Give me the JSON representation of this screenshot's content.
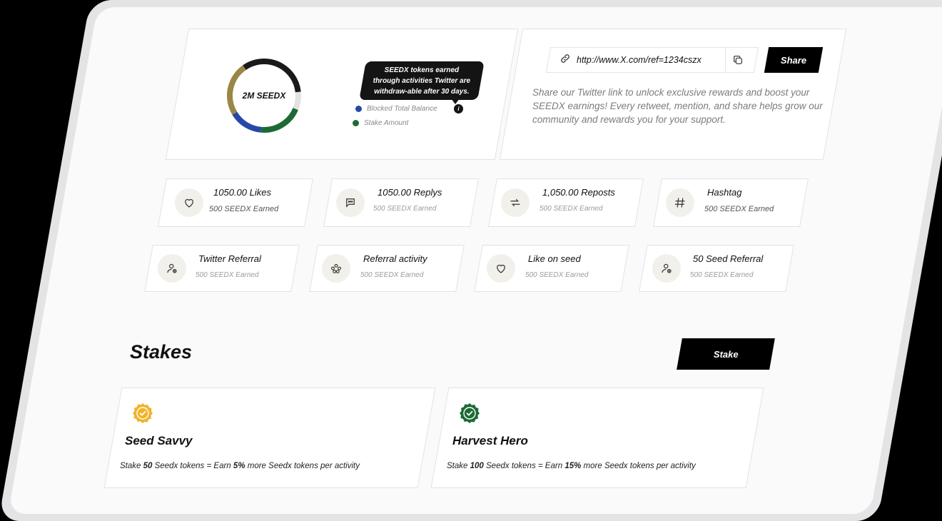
{
  "balance": {
    "total_label": "2M SEEDX",
    "tooltip": "SEEDX tokens earned through activities Twitter are withdraw-able after 30 days.",
    "info_glyph": "i",
    "legend": [
      {
        "label": "Blocked Total Balance",
        "color": "#2748a8"
      },
      {
        "label": "Stake Amount",
        "color": "#1c6b34"
      }
    ],
    "segments": [
      {
        "name": "black",
        "color": "#1a1a1a",
        "fraction": 0.33
      },
      {
        "name": "gray",
        "color": "#e2e2e2",
        "fraction": 0.08
      },
      {
        "name": "green",
        "color": "#1c6b34",
        "fraction": 0.2
      },
      {
        "name": "blue",
        "color": "#2748a8",
        "fraction": 0.15
      },
      {
        "name": "olive",
        "color": "#9a8645",
        "fraction": 0.24
      }
    ]
  },
  "share": {
    "link": "http://www.X.com/ref=1234cszx",
    "button_label": "Share",
    "description": "Share our Twitter link to unlock exclusive rewards and boost your SEEDX earnings! Every retweet, mention, and share helps grow our community and rewards you for your support."
  },
  "stats_row1": [
    {
      "title": "1050.00 Likes",
      "sub": "500 SEEDX Earned",
      "icon": "heart-icon"
    },
    {
      "title": "1050.00 Replys",
      "sub": "500 SEEDX Earned",
      "icon": "chat-icon"
    },
    {
      "title": "1,050.00 Reposts",
      "sub": "500 SEEDX Earned",
      "icon": "repost-icon"
    },
    {
      "title": "Hashtag",
      "sub": "500 SEEDX Earned",
      "icon": "hashtag-icon"
    }
  ],
  "stats_row2": [
    {
      "title": "Twitter Referral",
      "sub": "500 SEEDX Earned",
      "icon": "user-add-icon"
    },
    {
      "title": "Referral activity",
      "sub": "500 SEEDX Earned",
      "icon": "group-icon"
    },
    {
      "title": "Like on seed",
      "sub": "500 SEEDX Earned",
      "icon": "heart-icon"
    },
    {
      "title": "50 Seed Referral",
      "sub": "500 SEEDX Earned",
      "icon": "user-add-icon"
    }
  ],
  "stakes": {
    "title": "Stakes",
    "button_label": "Stake",
    "plans": [
      {
        "name": "Seed Savvy",
        "badge_color": "#f0b429",
        "stake_word": "Stake",
        "amount": "50",
        "mid": "Seedx tokens = Earn",
        "percent": "5%",
        "tail": "more Seedx tokens per activity"
      },
      {
        "name": "Harvest Hero",
        "badge_color": "#1c6b34",
        "stake_word": "Stake",
        "amount": "100",
        "mid": "Seedx tokens = Earn",
        "percent": "15%",
        "tail": "more Seedx tokens per activity"
      }
    ]
  }
}
